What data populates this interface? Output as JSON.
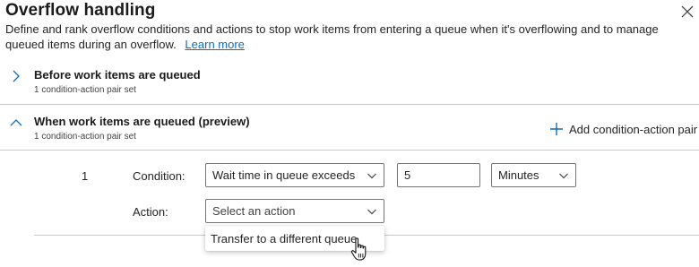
{
  "panel": {
    "title": "Overflow handling",
    "description": "Define and rank overflow conditions and actions to stop work items from entering a queue when it's overflowing and to manage queued items during an overflow.",
    "learn_more": "Learn more"
  },
  "sections": [
    {
      "title": "Before work items are queued",
      "subtitle": "1 condition-action pair set",
      "expanded": false
    },
    {
      "title": "When work items are queued (preview)",
      "subtitle": "1 condition-action pair set",
      "expanded": true,
      "add_button_label": "Add condition-action pair"
    }
  ],
  "pair": {
    "index": "1",
    "condition_label": "Condition:",
    "condition_value": "Wait time in queue exceeds",
    "threshold_value": "5",
    "unit_value": "Minutes",
    "action_label": "Action:",
    "action_placeholder": "Select an action"
  },
  "action_menu": {
    "options": [
      "Transfer to a different queue"
    ]
  },
  "icons": {
    "close": "close-icon",
    "collapsed": "chevron-right-icon",
    "expanded": "chevron-up-icon",
    "add": "plus-icon",
    "dropdown": "chevron-down-icon",
    "pointer": "hand-pointer-icon"
  },
  "colors": {
    "link": "#0f6cbd",
    "text": "#242424",
    "divider": "#c8c8c8"
  }
}
